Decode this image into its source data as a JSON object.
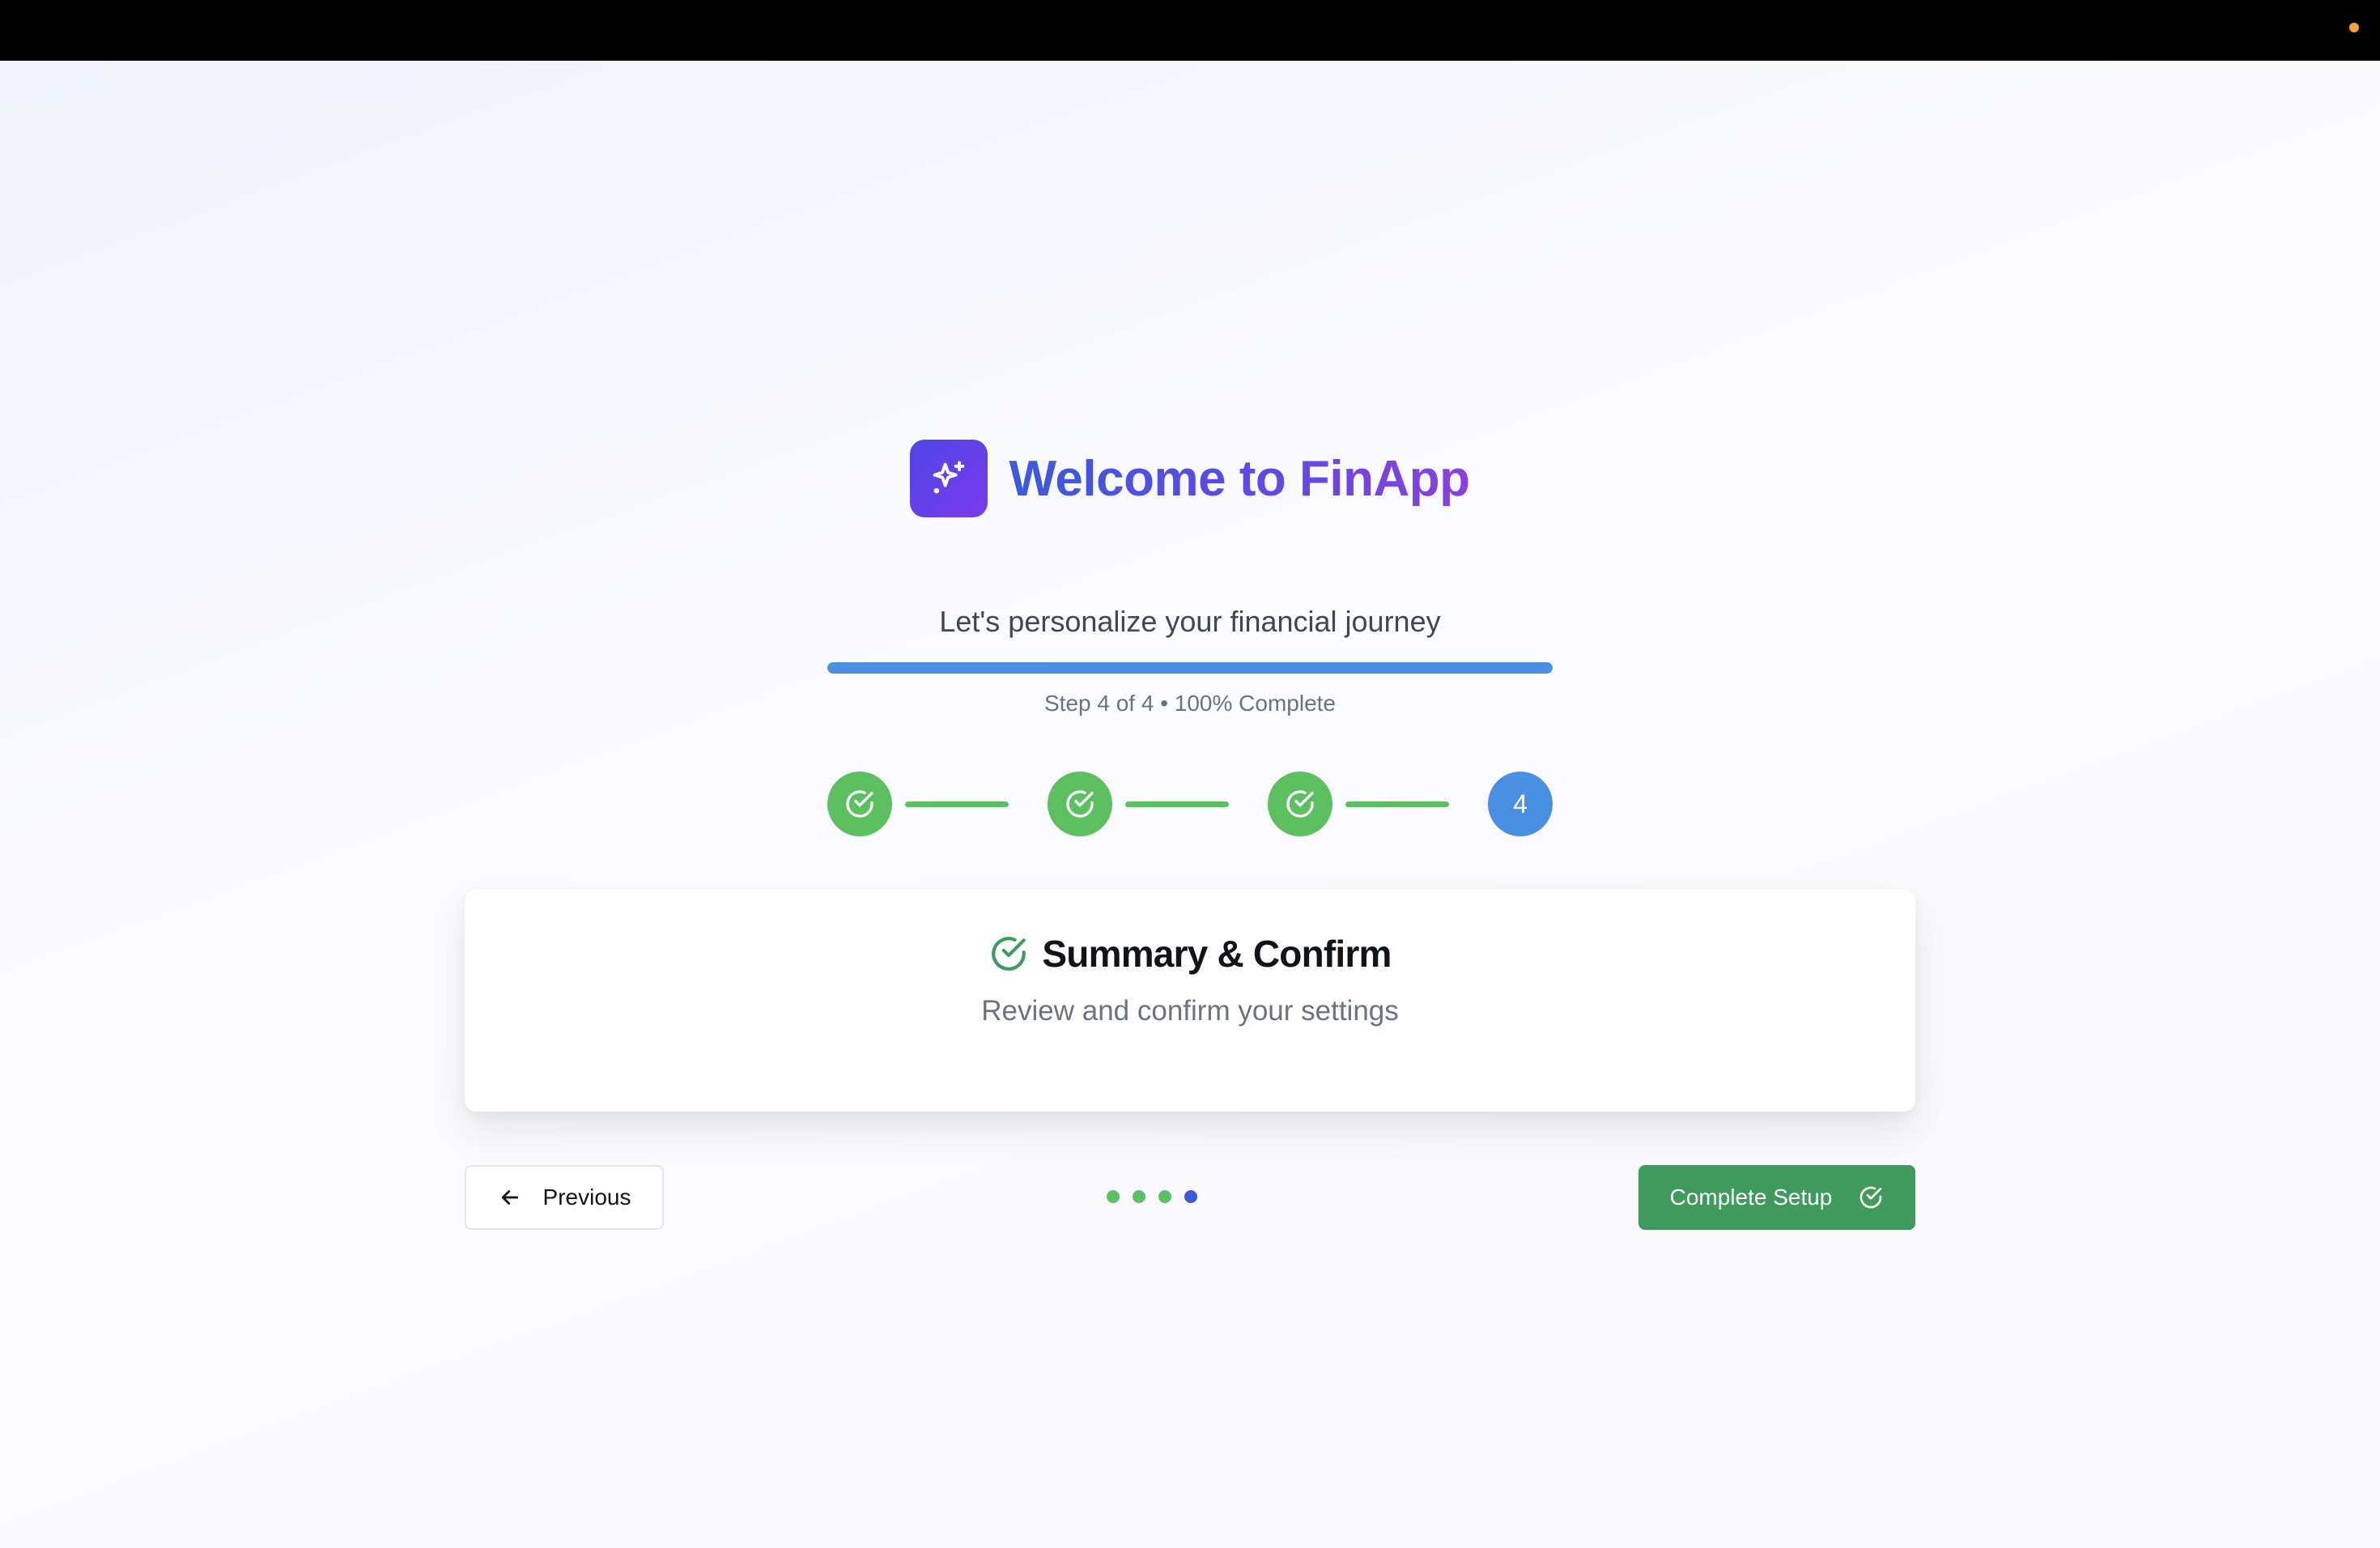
{
  "header": {
    "title": "Welcome to FinApp",
    "logo_icon": "sparkles-icon",
    "subtitle": "Let's personalize your financial journey"
  },
  "progress": {
    "value": 1.0,
    "step_text": "Step 4 of 4 • 100% Complete"
  },
  "stepper": {
    "steps": [
      {
        "state": "done",
        "icon": "check-circle-icon"
      },
      {
        "state": "done",
        "icon": "check-circle-icon"
      },
      {
        "state": "done",
        "icon": "check-circle-icon"
      },
      {
        "state": "current",
        "label": "4"
      }
    ]
  },
  "card": {
    "icon": "check-circle-icon",
    "title": "Summary & Confirm",
    "subtitle": "Review and confirm your settings"
  },
  "nav": {
    "previous_label": "Previous",
    "previous_icon": "arrow-left-icon",
    "complete_label": "Complete Setup",
    "complete_icon": "check-circle-icon",
    "page_dots": [
      "done",
      "done",
      "done",
      "current"
    ]
  },
  "colors": {
    "primary": "#4a90e2",
    "success": "#5cbf60",
    "complete_button": "#3f9a5e",
    "brand_gradient_start": "#4f46e5",
    "brand_gradient_end": "#7c3aed"
  }
}
